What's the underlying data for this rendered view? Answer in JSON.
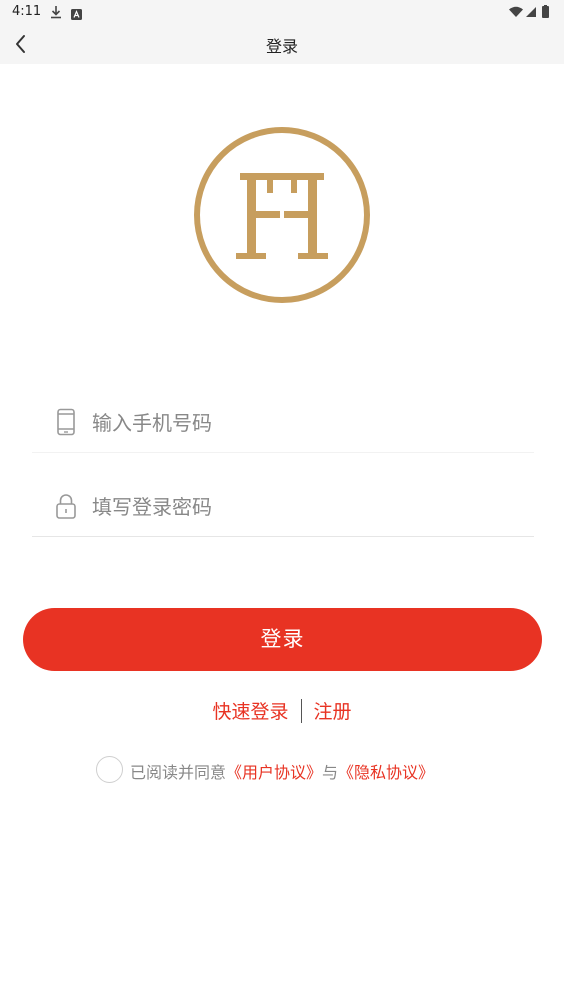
{
  "status_bar": {
    "time": "4:11"
  },
  "nav": {
    "title": "登录"
  },
  "form": {
    "phone_placeholder": "输入手机号码",
    "password_placeholder": "填写登录密码",
    "login_label": "登录"
  },
  "links": {
    "quick_login": "快速登录",
    "register": "注册"
  },
  "agreement": {
    "prefix": "已阅读并同意",
    "user_agreement": "《用户协议》",
    "conjunction": "与",
    "privacy_agreement": "《隐私协议》"
  },
  "colors": {
    "accent": "#e83323",
    "logo_gold": "#c79e5e"
  }
}
